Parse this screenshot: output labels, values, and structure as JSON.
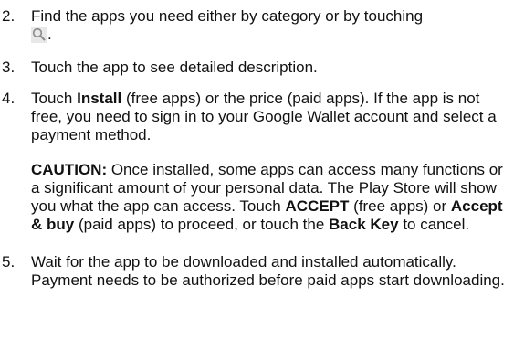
{
  "steps": [
    {
      "number": "2.",
      "text_before_icon": "Find the apps you need either by category or by touching",
      "icon": "search-icon",
      "text_after_icon": "."
    },
    {
      "number": "3.",
      "text": "Touch the app to see detailed description."
    },
    {
      "number": "4.",
      "prefix": "Touch ",
      "bold1": "Install",
      "rest": " (free apps) or the price (paid apps). If the app is not free, you need to sign in to your Google Wallet account and select a payment method."
    },
    {
      "number": "5.",
      "text": "Wait for the app to be downloaded and installed automatically. Payment needs to be authorized before paid apps start downloading."
    }
  ],
  "caution": {
    "label": "CAUTION:",
    "text1": " Once installed, some apps can access many functions or a significant amount of your personal data. The Play Store will show you what the app can access. Touch ",
    "bold_accept": "ACCEPT",
    "text2": " (free apps) or ",
    "bold_accept_buy": "Accept & buy",
    "text3": " (paid apps) to proceed, or touch the ",
    "bold_back": "Back Key",
    "text4": " to cancel."
  }
}
